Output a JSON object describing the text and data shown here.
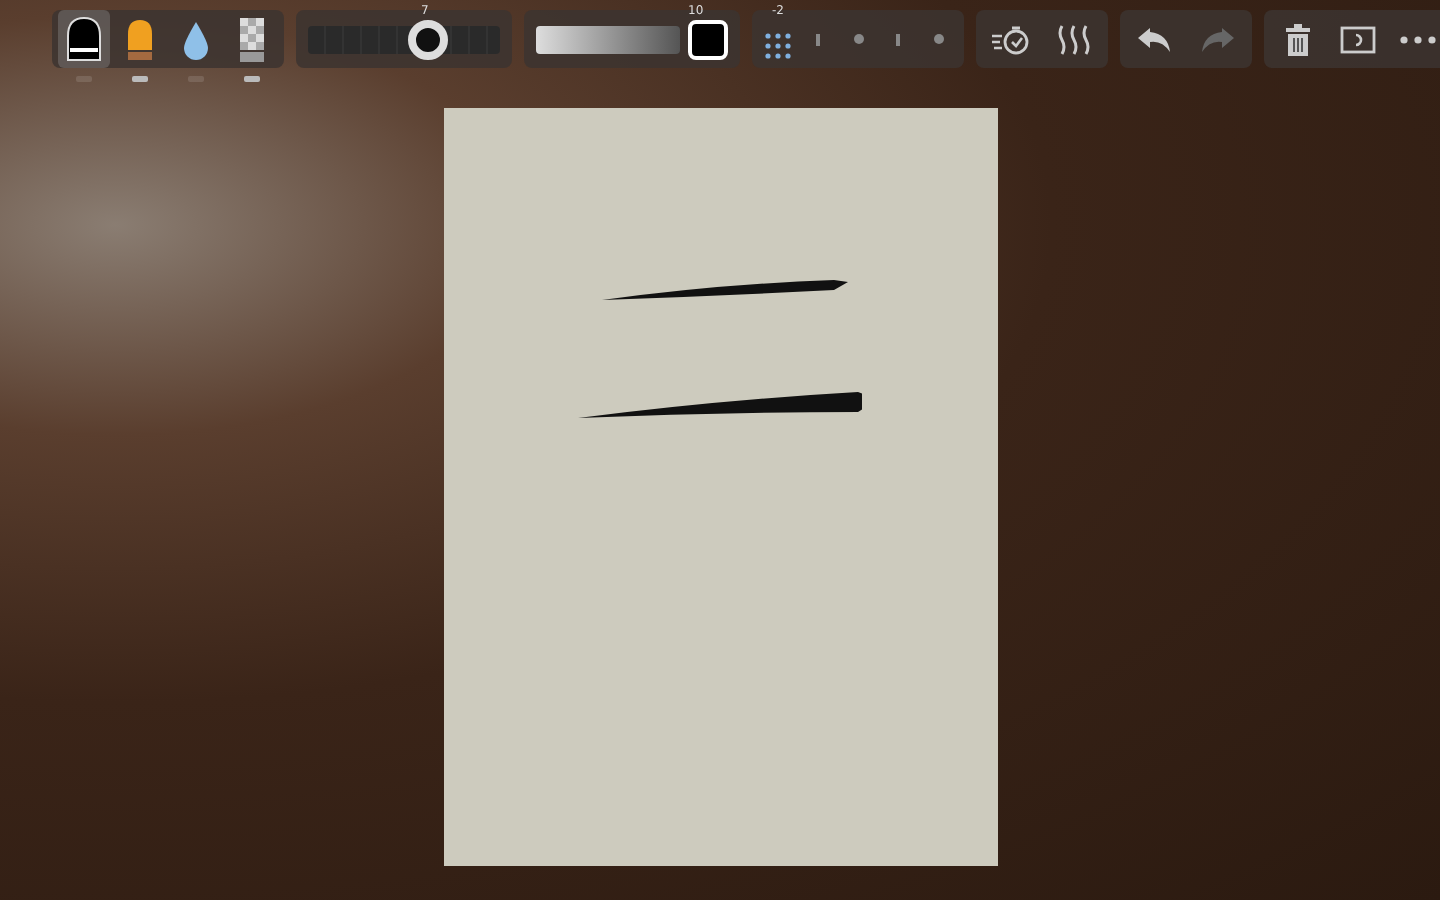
{
  "tools": [
    {
      "kind": "brush",
      "selected": true,
      "marked": false
    },
    {
      "kind": "ink",
      "selected": false,
      "marked": true
    },
    {
      "kind": "water",
      "selected": false,
      "marked": false
    },
    {
      "kind": "texture",
      "selected": false,
      "marked": true
    }
  ],
  "size": {
    "reading": "7",
    "level": 0.62
  },
  "opacity": {
    "reading": "10",
    "level": 1
  },
  "grid": {
    "reading": "-2",
    "options": [
      {
        "kind": "line",
        "selected": false
      },
      {
        "kind": "dot",
        "selected": false
      },
      {
        "kind": "line",
        "selected": false
      },
      {
        "kind": "dot",
        "selected": false
      }
    ]
  },
  "history": {
    "undo_disabled": false,
    "redo_disabled": true
  }
}
